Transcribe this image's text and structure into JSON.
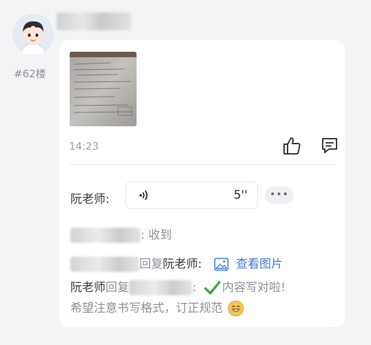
{
  "post": {
    "floor": "#62楼",
    "author_name": "",
    "time": "14:23"
  },
  "replies": [
    {
      "author": "阮老师",
      "colon": ":",
      "voice_duration": "5''",
      "more_label": "•••"
    },
    {
      "author": "",
      "colon": ":",
      "text": "收到"
    },
    {
      "author": "",
      "reply_word": "回复",
      "target": "阮老师",
      "colon": ":",
      "link_text": "查看图片"
    },
    {
      "author": "阮老师",
      "reply_word": "回复",
      "target": "",
      "colon": ":",
      "text1": "内容写对啦!",
      "text2": "希望注意书写格式，订正规范"
    }
  ],
  "colors": {
    "link": "#3b78d8",
    "check": "#3aa845",
    "emoji": "#f4c64b"
  },
  "icons": [
    "avatar-cartoon-boy",
    "thumbs-up-icon",
    "comment-icon",
    "voice-wave-icon",
    "image-icon",
    "check-icon",
    "smile-emoji-icon"
  ]
}
